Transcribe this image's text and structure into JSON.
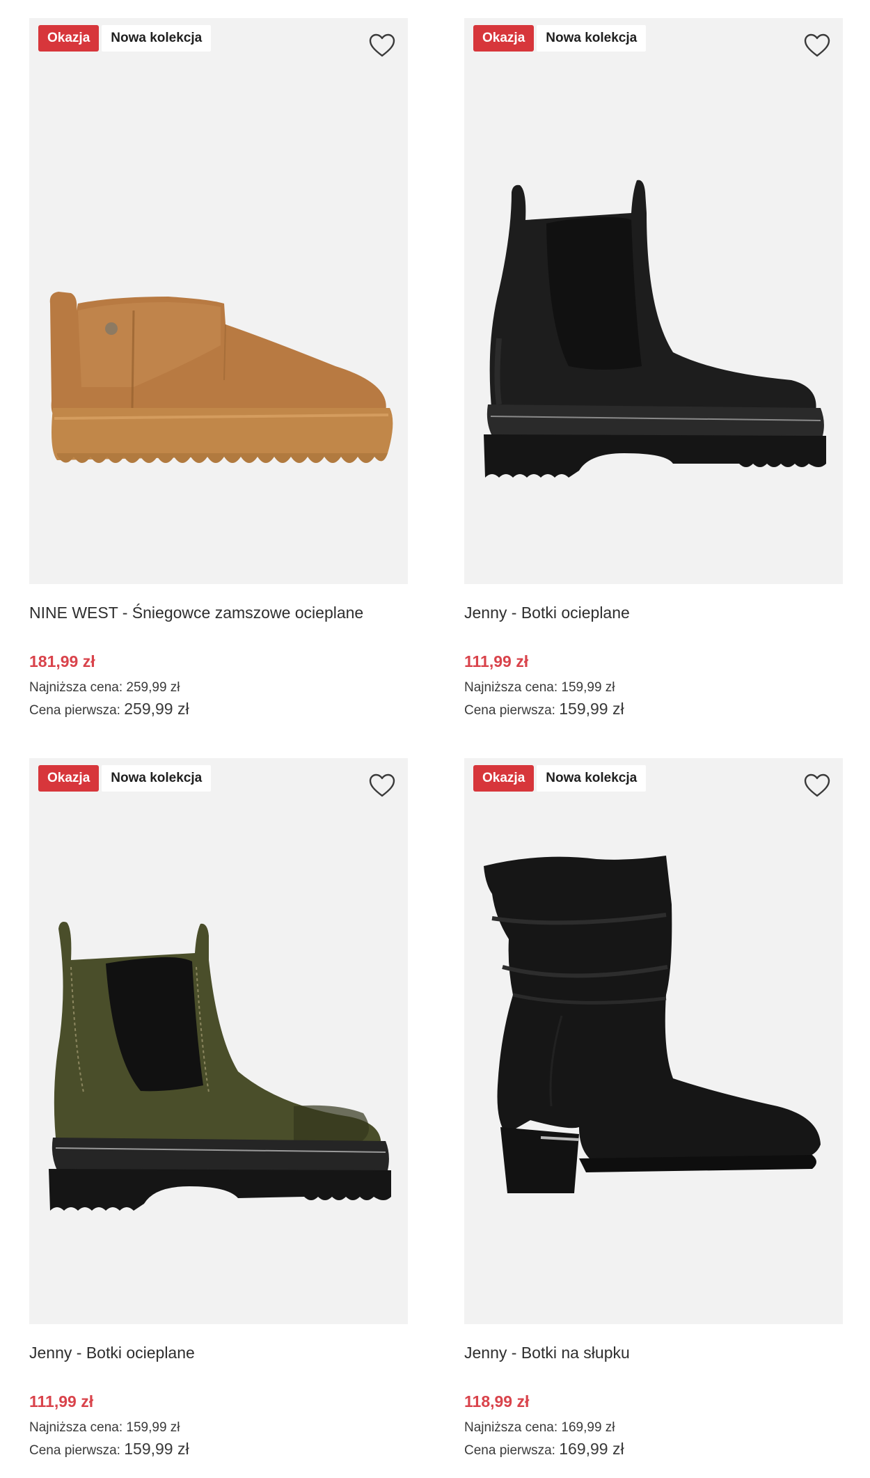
{
  "theme": {
    "deal_color": "#d7363b",
    "price_color": "#d9434b"
  },
  "products": [
    {
      "deal_badge": "Okazja",
      "new_badge": "Nowa kolekcja",
      "name": "NINE WEST - Śniegowce zamszowe ocieplane",
      "price": "181,99 zł",
      "lowest_label": "Najniższa cena:",
      "lowest_value": "259,99 zł",
      "first_label": "Cena pierwsza:",
      "first_value": "259,99 zł",
      "favorite_icon": "heart-icon",
      "image": "tan-suede-mini-snow-boot"
    },
    {
      "deal_badge": "Okazja",
      "new_badge": "Nowa kolekcja",
      "name": "Jenny - Botki ocieplane",
      "price": "111,99 zł",
      "lowest_label": "Najniższa cena:",
      "lowest_value": "159,99 zł",
      "first_label": "Cena pierwsza:",
      "first_value": "159,99 zł",
      "favorite_icon": "heart-icon",
      "image": "black-chelsea-boot"
    },
    {
      "deal_badge": "Okazja",
      "new_badge": "Nowa kolekcja",
      "name": "Jenny - Botki ocieplane",
      "price": "111,99 zł",
      "lowest_label": "Najniższa cena:",
      "lowest_value": "159,99 zł",
      "first_label": "Cena pierwsza:",
      "first_value": "159,99 zł",
      "favorite_icon": "heart-icon",
      "image": "olive-chelsea-boot"
    },
    {
      "deal_badge": "Okazja",
      "new_badge": "Nowa kolekcja",
      "name": "Jenny - Botki na słupku",
      "price": "118,99 zł",
      "lowest_label": "Najniższa cena:",
      "lowest_value": "169,99 zł",
      "first_label": "Cena pierwsza:",
      "first_value": "169,99 zł",
      "favorite_icon": "heart-icon",
      "image": "black-slouch-heel-boot"
    }
  ]
}
